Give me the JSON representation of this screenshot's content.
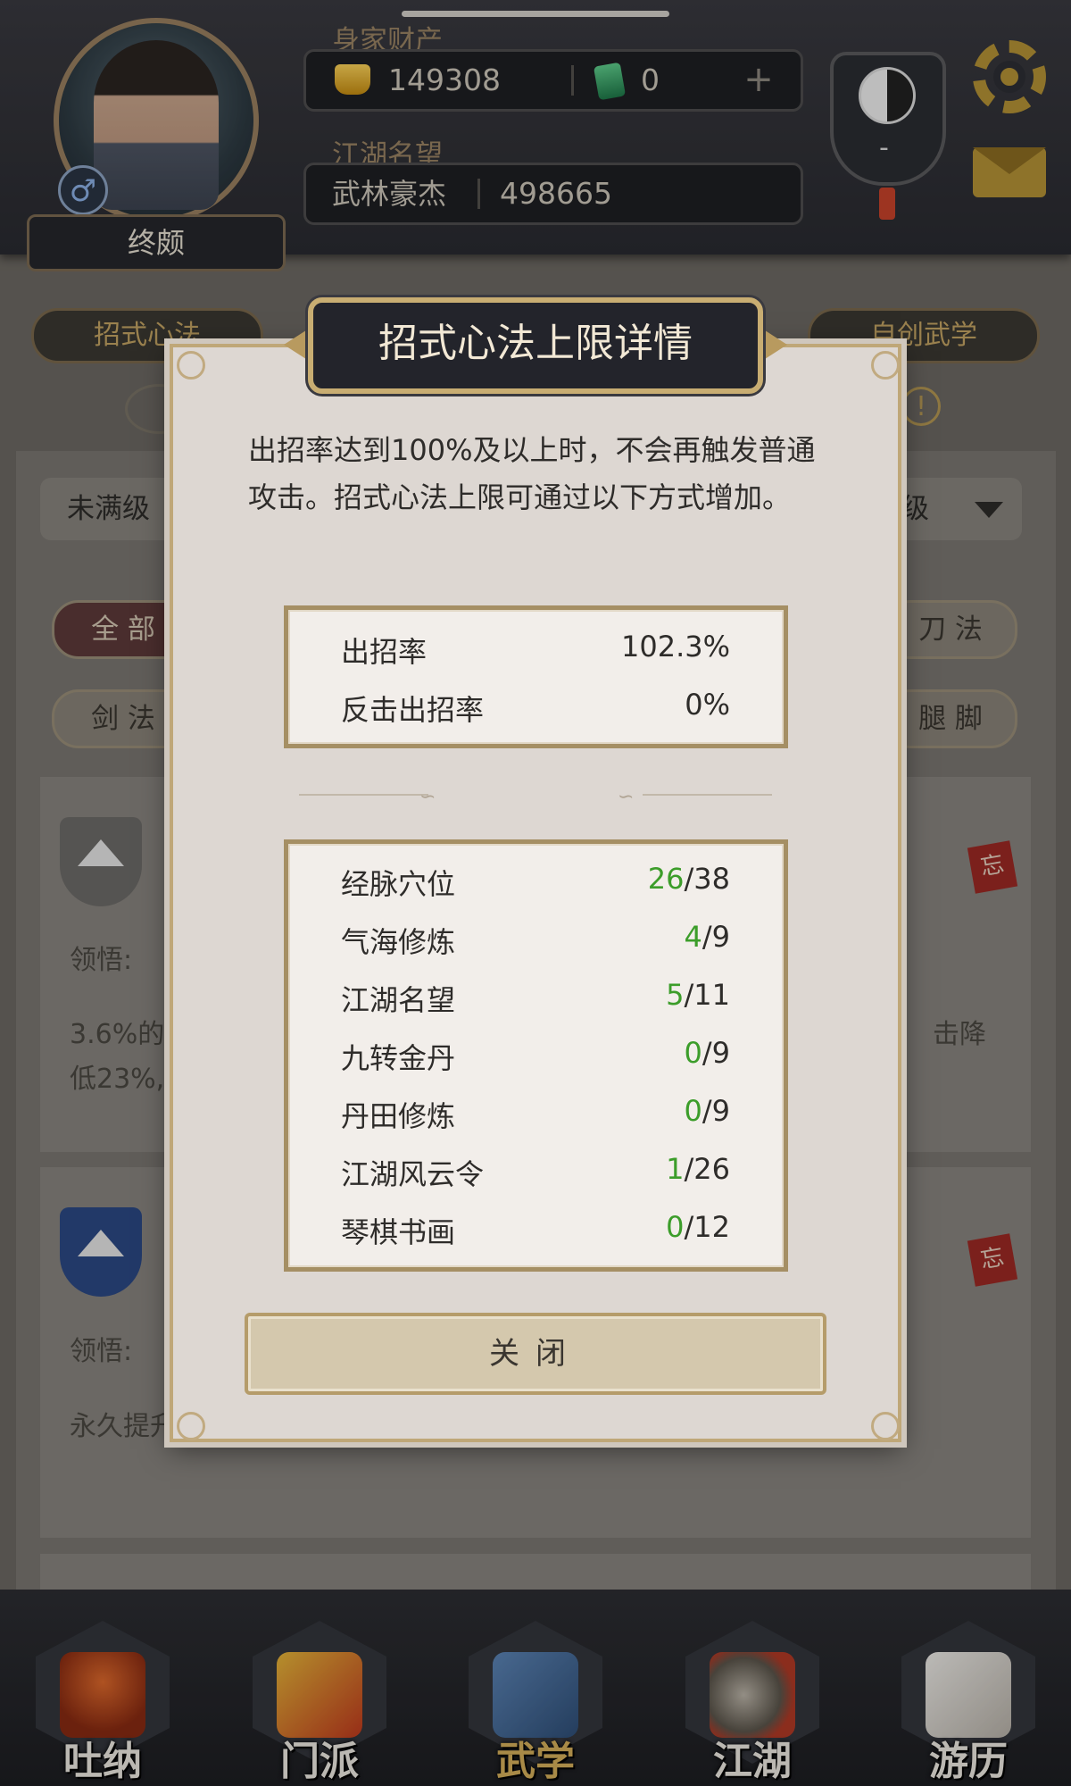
{
  "header": {
    "character_name": "终颇",
    "gender_symbol": "♂",
    "wealth_label": "身家财产",
    "silver_value": "149308",
    "jade_value": "0",
    "plus_symbol": "+",
    "reputation_label": "江湖名望",
    "reputation_title": "武林豪杰",
    "reputation_value": "498665",
    "badge_dash": "-"
  },
  "background": {
    "tab_left": "招式心法",
    "tab_right": "自创武学",
    "info_symbol": "!",
    "filter_left": "未满级",
    "filter_right": "级",
    "cat_all": "全 部",
    "cat_sword": "剑 法",
    "cat_blade": "刀 法",
    "cat_leg": "腿 脚",
    "card1_label": "领悟:",
    "card1_desc_line1": "3.6%的",
    "card1_desc_line2": "低23%,",
    "card1_desc_right": "击降",
    "card2_label": "领悟:",
    "card2_desc": "永久提升",
    "tag_char": "忘"
  },
  "modal": {
    "title": "招式心法上限详情",
    "description": "出招率达到100%及以上时，不会再触发普通攻击。招式心法上限可通过以下方式增加。",
    "rates": [
      {
        "label": "出招率",
        "value": "102.3%"
      },
      {
        "label": "反击出招率",
        "value": "0%"
      }
    ],
    "sources": [
      {
        "label": "经脉穴位",
        "current": "26",
        "max": "/38"
      },
      {
        "label": "气海修炼",
        "current": "4",
        "max": "/9"
      },
      {
        "label": "江湖名望",
        "current": "5",
        "max": "/11"
      },
      {
        "label": "九转金丹",
        "current": "0",
        "max": "/9"
      },
      {
        "label": "丹田修炼",
        "current": "0",
        "max": "/9"
      },
      {
        "label": "江湖风云令",
        "current": "1",
        "max": "/26"
      },
      {
        "label": "琴棋书画",
        "current": "0",
        "max": "/12"
      }
    ],
    "close_label": "关闭"
  },
  "bottom_nav": {
    "items": [
      {
        "label": "吐纳"
      },
      {
        "label": "门派"
      },
      {
        "label": "武学"
      },
      {
        "label": "江湖"
      },
      {
        "label": "游历"
      }
    ]
  },
  "colors": {
    "accent_gold": "#c8ad72",
    "progress_green": "#3c9d2a",
    "modal_bg": "#ddd7d2"
  }
}
